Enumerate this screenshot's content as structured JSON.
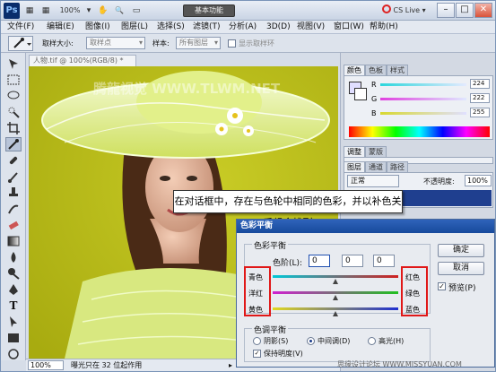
{
  "titlebar": {
    "logo": "Ps",
    "workspace": "基本功能",
    "cs_live": "CS Live",
    "win_min": "–",
    "win_max": "□",
    "win_close": "✕",
    "controls": [
      "▦",
      "▦",
      "100%",
      "▾",
      "✋",
      "🔍",
      "▭"
    ]
  },
  "menubar": {
    "items": [
      "文件(F)",
      "编辑(E)",
      "图像(I)",
      "图层(L)",
      "选择(S)",
      "滤镜(T)",
      "分析(A)",
      "3D(D)",
      "视图(V)",
      "窗口(W)",
      "帮助(H)"
    ]
  },
  "options": {
    "sample_size_label": "取样大小:",
    "sample_size_value": "取样点",
    "sample_label": "样本:",
    "sample_value": "所有图层",
    "show_ring_label": "显示取样环"
  },
  "document": {
    "tab_title": "人物.tif @ 100%(RGB/8) *",
    "watermark": "腾龍视觉 WWW.TLWM.NET"
  },
  "status": {
    "zoom": "100%",
    "message": "曝光只在 32 位起作用"
  },
  "color_panel": {
    "tabs": [
      "颜色",
      "色板",
      "样式"
    ],
    "channels": [
      {
        "label": "R",
        "value": "224"
      },
      {
        "label": "G",
        "value": "222"
      },
      {
        "label": "B",
        "value": "255"
      }
    ],
    "colors": {
      "r_track": "#22cfd8",
      "g_track": "#e040e0",
      "b_track": "#d8d830"
    }
  },
  "adjust_panel": {
    "tabs": [
      "调整",
      "蒙版"
    ]
  },
  "layers_panel": {
    "tabs": [
      "图层",
      "通道",
      "路径"
    ],
    "blend_mode": "正常",
    "opacity_label": "不透明度:",
    "opacity_value": "100%"
  },
  "callout": {
    "text": "在对话框中，存在与色轮中相同的色彩，并以补色关系组合排列"
  },
  "dialog": {
    "title": "色彩平衡",
    "balance_group": "色彩平衡",
    "levels_label": "色阶(L):",
    "levels": [
      "0",
      "0",
      "0"
    ],
    "sliders": [
      {
        "left": "青色",
        "right": "红色",
        "position": 0.5
      },
      {
        "left": "洋红",
        "right": "绿色",
        "position": 0.5
      },
      {
        "left": "黄色",
        "right": "蓝色",
        "position": 0.5
      }
    ],
    "tone_group": "色调平衡",
    "tones": [
      "阴影(S)",
      "中间调(D)",
      "高光(H)"
    ],
    "selected_tone": "中间调(D)",
    "preserve_label": "保持明度(V)",
    "ok": "确定",
    "cancel": "取消",
    "preview_label": "预览(P)",
    "preview_checked": true
  },
  "site_watermark": "思缘设计论坛 WWW.MISSYUAN.COM",
  "accent_colors": {
    "highlight": "#e01818",
    "dialog_title": "#1f55a8",
    "canvas_bg": "#bfc31a"
  }
}
